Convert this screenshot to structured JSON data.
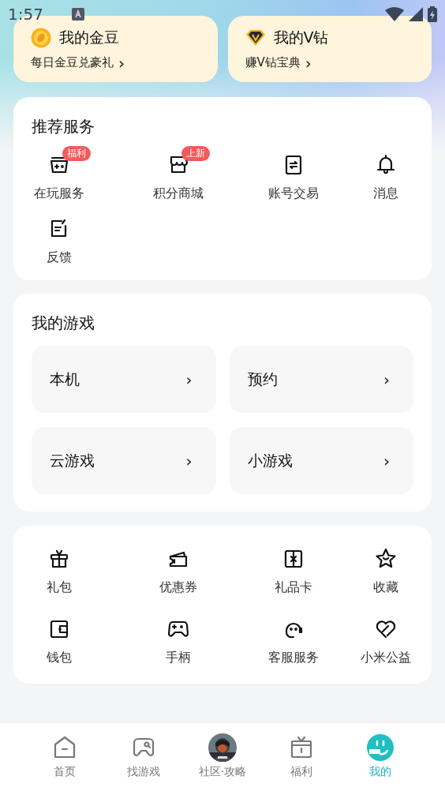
{
  "status_bar": {
    "time": "1:57"
  },
  "wallet_cards": [
    {
      "kind": "coin",
      "title": "我的金豆",
      "link": "每日金豆兑豪礼",
      "chevron": "›"
    },
    {
      "kind": "diamond",
      "title": "我的V钻",
      "link": "赚V钻宝典",
      "chevron": "›"
    }
  ],
  "services": {
    "title": "推荐服务",
    "items": [
      {
        "label": "在玩服务",
        "badge": "福利"
      },
      {
        "label": "积分商城",
        "badge": "上新"
      },
      {
        "label": "账号交易"
      },
      {
        "label": "消息"
      },
      {
        "label": "反馈"
      }
    ]
  },
  "my_games": {
    "title": "我的游戏",
    "items": [
      {
        "label": "本机",
        "chevron": "›"
      },
      {
        "label": "预约",
        "chevron": "›"
      },
      {
        "label": "云游戏",
        "chevron": "›"
      },
      {
        "label": "小游戏",
        "chevron": "›"
      }
    ]
  },
  "tools": {
    "items": [
      {
        "label": "礼包"
      },
      {
        "label": "优惠券"
      },
      {
        "label": "礼品卡"
      },
      {
        "label": "收藏"
      },
      {
        "label": "钱包"
      },
      {
        "label": "手柄"
      },
      {
        "label": "客服服务"
      },
      {
        "label": "小米公益"
      }
    ]
  },
  "bottom_nav": [
    {
      "kind": "home",
      "label": "首页",
      "selected": false
    },
    {
      "kind": "find",
      "label": "找游戏",
      "selected": false
    },
    {
      "kind": "avatar",
      "label": "社区·攻略",
      "selected": false
    },
    {
      "kind": "gift",
      "label": "福利",
      "selected": false
    },
    {
      "kind": "me",
      "label": "我的",
      "selected": true
    }
  ]
}
